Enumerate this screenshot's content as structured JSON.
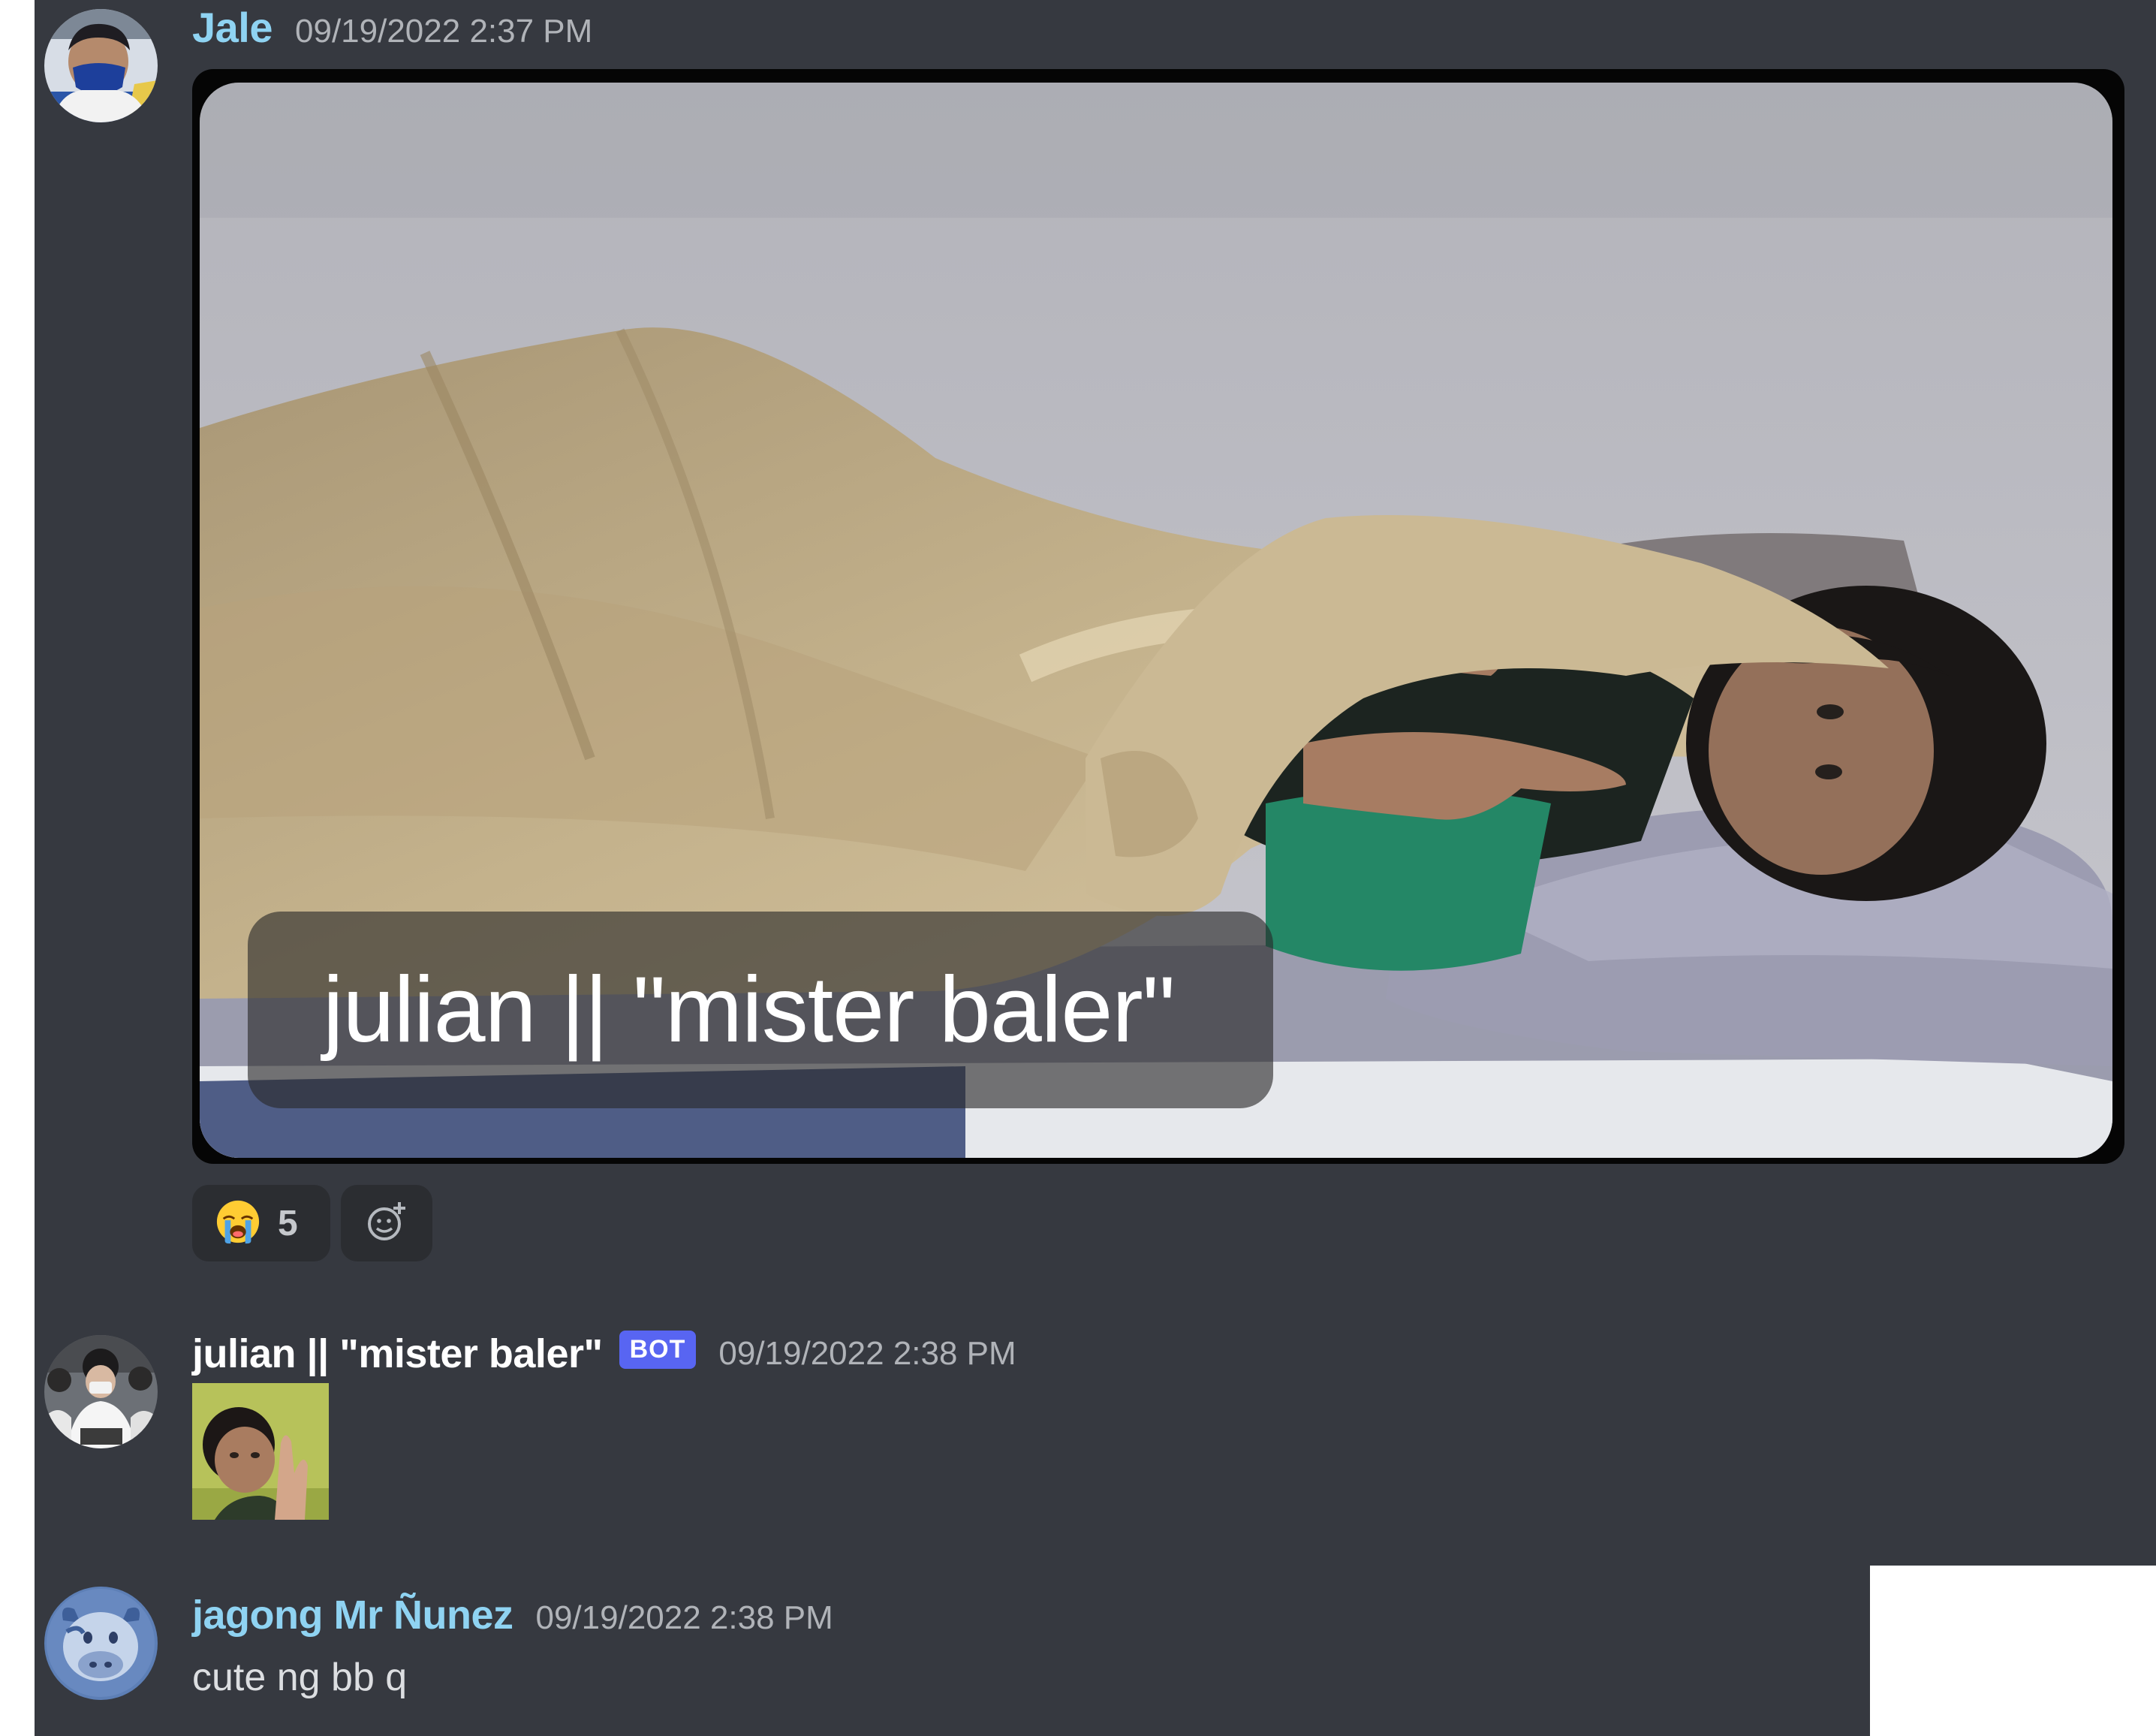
{
  "messages": [
    {
      "author": "Jale",
      "timestamp": "09/19/2022 2:37 PM",
      "attachment": {
        "type": "image",
        "overlay_caption": "julian || \"mister baler\""
      },
      "reactions": [
        {
          "emoji": "😭",
          "count": "5"
        }
      ],
      "add_reaction_icon": "add-emoji-icon"
    },
    {
      "author": "julian || \"mister baler\"",
      "badge": "BOT",
      "timestamp": "09/19/2022 2:38 PM",
      "attachment": {
        "type": "image-thumbnail"
      }
    },
    {
      "author": "jagong Mr Ñunez",
      "timestamp": "09/19/2022 2:38 PM",
      "text": "cute ng bb q"
    }
  ],
  "colors": {
    "background": "#363940",
    "username_accent": "#8fd3f2",
    "bot_badge": "#5865f2",
    "timestamp": "#b0b3b8"
  }
}
